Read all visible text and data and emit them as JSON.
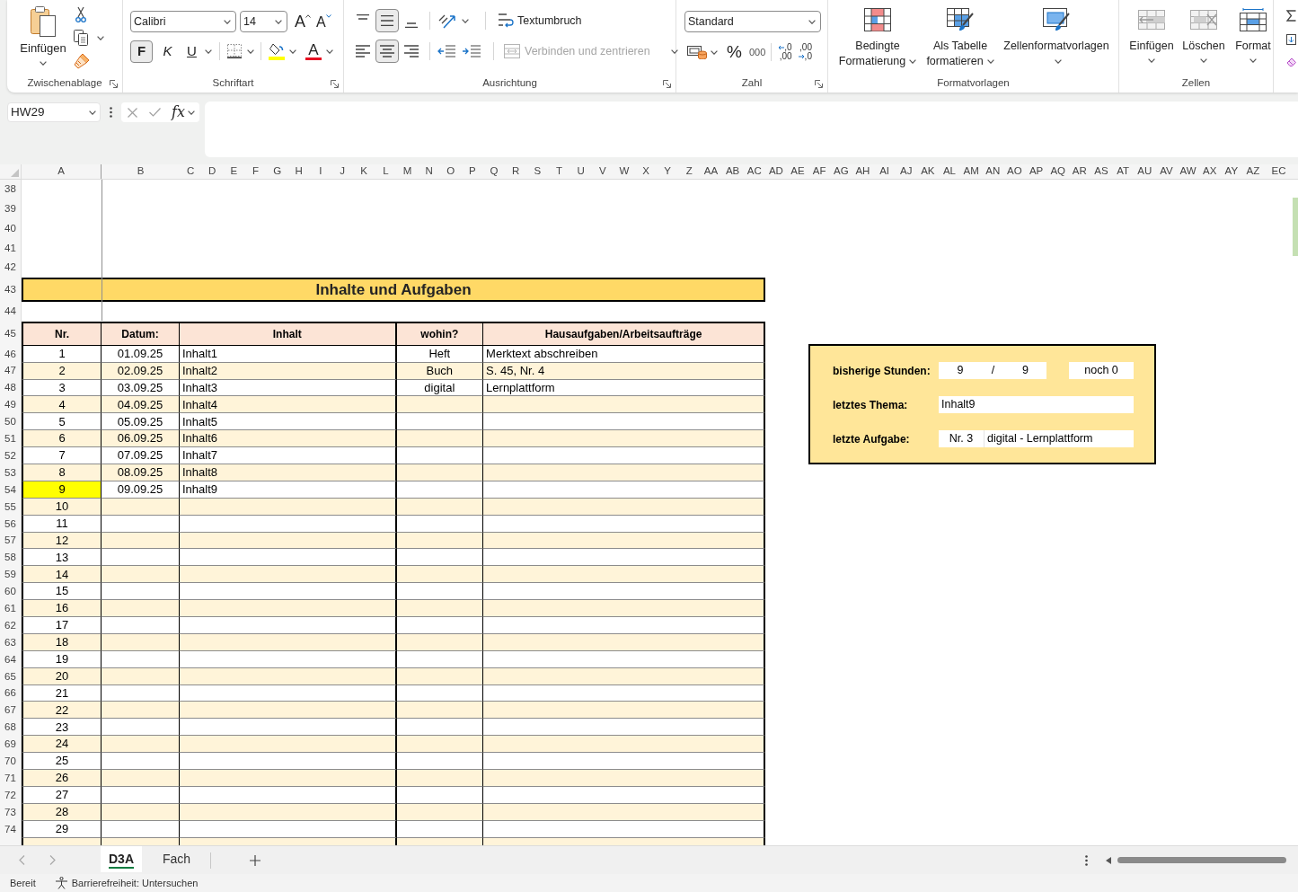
{
  "ribbon": {
    "clipboard": {
      "paste": "Einfügen",
      "label": "Zwischenablage"
    },
    "font": {
      "font_name": "Calibri",
      "font_size": "14",
      "grow_glyph": "A",
      "shrink_glyph": "A",
      "styles": [
        {
          "label": "F",
          "selected": true
        },
        {
          "label": "K",
          "selected": false
        },
        {
          "label": "U",
          "selected": false
        }
      ],
      "font_color_glyph": "A",
      "label": "Schriftart"
    },
    "alignment": {
      "vertical": [
        {
          "kind": "top",
          "selected": false
        },
        {
          "kind": "middle",
          "selected": true
        },
        {
          "kind": "bottom",
          "selected": false
        }
      ],
      "wrap_text": "Textumbruch",
      "horizontal": [
        {
          "kind": "left",
          "selected": false
        },
        {
          "kind": "center",
          "selected": true
        },
        {
          "kind": "right",
          "selected": false
        }
      ],
      "merge": {
        "label": "Verbinden und zentrieren",
        "disabled": true
      },
      "label": "Ausrichtung"
    },
    "number": {
      "format": "Standard",
      "percent": "%",
      "thousands": "000",
      "decimals": [
        {
          "kind": "increase",
          "upper": ",0",
          "lower": ",00"
        },
        {
          "kind": "decrease",
          "upper": ",00",
          "lower": ",0"
        }
      ],
      "label": "Zahl"
    },
    "styles": {
      "buttons": [
        {
          "kind": "conditional",
          "label": "Bedingte Formatierung"
        },
        {
          "kind": "table",
          "label": "Als Tabelle formatieren"
        },
        {
          "kind": "cell_styles",
          "label": "Zellenformatvorlagen"
        }
      ],
      "label": "Formatvorlagen"
    },
    "cells": {
      "buttons": [
        {
          "kind": "insert",
          "label": "Einfügen"
        },
        {
          "kind": "delete",
          "label": "Löschen"
        },
        {
          "kind": "format",
          "label": "Format"
        }
      ],
      "label": "Zellen"
    }
  },
  "formula_bar": {
    "name_box": "HW29",
    "function_label": "fx"
  },
  "sheet": {
    "column_headers": [
      "A",
      "B",
      "C",
      "D",
      "E",
      "F",
      "G",
      "H",
      "I",
      "J",
      "K",
      "L",
      "M",
      "N",
      "O",
      "P",
      "Q",
      "R",
      "S",
      "T",
      "U",
      "V",
      "W",
      "X",
      "Y",
      "Z",
      "AA",
      "AB",
      "AC",
      "AD",
      "AE",
      "AF",
      "AG",
      "AH",
      "AI",
      "AJ",
      "AK",
      "AL",
      "AM",
      "AN",
      "AO",
      "AP",
      "AQ",
      "AR",
      "AS",
      "AT",
      "AU",
      "AV",
      "AW",
      "AX",
      "AY",
      "AZ",
      "EC"
    ],
    "rows": [
      {
        "number": "38",
        "kind": "blank"
      },
      {
        "number": "39",
        "kind": "blank"
      },
      {
        "number": "40",
        "kind": "blank"
      },
      {
        "number": "41",
        "kind": "blank"
      },
      {
        "number": "42",
        "kind": "blank"
      },
      {
        "number": "43",
        "kind": "title",
        "title": "Inhalte und Aufgaben"
      },
      {
        "number": "44",
        "kind": "blank"
      },
      {
        "number": "45",
        "kind": "header",
        "cells": [
          "Nr.",
          "Datum:",
          "Inhalt",
          "wohin?",
          "Hausaufgaben/Arbeitsaufträge"
        ]
      },
      {
        "number": "46",
        "kind": "entry",
        "nr": "1",
        "date": "01.09.25",
        "content": "Inhalt1",
        "where": "Heft",
        "task": "Merktext abschreiben",
        "highlighted": false
      },
      {
        "number": "47",
        "kind": "entry",
        "nr": "2",
        "date": "02.09.25",
        "content": "Inhalt2",
        "where": "Buch",
        "task": "S. 45, Nr. 4",
        "highlighted": false
      },
      {
        "number": "48",
        "kind": "entry",
        "nr": "3",
        "date": "03.09.25",
        "content": "Inhalt3",
        "where": "digital",
        "task": "Lernplattform",
        "highlighted": false
      },
      {
        "number": "49",
        "kind": "entry",
        "nr": "4",
        "date": "04.09.25",
        "content": "Inhalt4",
        "highlighted": false
      },
      {
        "number": "50",
        "kind": "entry",
        "nr": "5",
        "date": "05.09.25",
        "content": "Inhalt5",
        "highlighted": false
      },
      {
        "number": "51",
        "kind": "entry",
        "nr": "6",
        "date": "06.09.25",
        "content": "Inhalt6",
        "highlighted": false
      },
      {
        "number": "52",
        "kind": "entry",
        "nr": "7",
        "date": "07.09.25",
        "content": "Inhalt7",
        "highlighted": false
      },
      {
        "number": "53",
        "kind": "entry",
        "nr": "8",
        "date": "08.09.25",
        "content": "Inhalt8",
        "highlighted": false
      },
      {
        "number": "54",
        "kind": "entry",
        "nr": "9",
        "date": "09.09.25",
        "content": "Inhalt9",
        "highlighted": true
      },
      {
        "number": "55",
        "kind": "entry",
        "nr": "10",
        "highlighted": false
      },
      {
        "number": "56",
        "kind": "entry",
        "nr": "11",
        "highlighted": false
      },
      {
        "number": "57",
        "kind": "entry",
        "nr": "12",
        "highlighted": false
      },
      {
        "number": "58",
        "kind": "entry",
        "nr": "13",
        "highlighted": false
      },
      {
        "number": "59",
        "kind": "entry",
        "nr": "14",
        "highlighted": false
      },
      {
        "number": "60",
        "kind": "entry",
        "nr": "15",
        "highlighted": false
      },
      {
        "number": "61",
        "kind": "entry",
        "nr": "16",
        "highlighted": false
      },
      {
        "number": "62",
        "kind": "entry",
        "nr": "17",
        "highlighted": false
      },
      {
        "number": "63",
        "kind": "entry",
        "nr": "18",
        "highlighted": false
      },
      {
        "number": "64",
        "kind": "entry",
        "nr": "19",
        "highlighted": false
      },
      {
        "number": "65",
        "kind": "entry",
        "nr": "20",
        "highlighted": false
      },
      {
        "number": "66",
        "kind": "entry",
        "nr": "21",
        "highlighted": false
      },
      {
        "number": "67",
        "kind": "entry",
        "nr": "22",
        "highlighted": false
      },
      {
        "number": "68",
        "kind": "entry",
        "nr": "23",
        "highlighted": false
      },
      {
        "number": "69",
        "kind": "entry",
        "nr": "24",
        "highlighted": false
      },
      {
        "number": "70",
        "kind": "entry",
        "nr": "25",
        "highlighted": false
      },
      {
        "number": "71",
        "kind": "entry",
        "nr": "26",
        "highlighted": false
      },
      {
        "number": "72",
        "kind": "entry",
        "nr": "27",
        "highlighted": false
      },
      {
        "number": "73",
        "kind": "entry",
        "nr": "28",
        "highlighted": false
      },
      {
        "number": "74",
        "kind": "entry",
        "nr": "29",
        "highlighted": false
      }
    ],
    "summary": {
      "hours_label": "bisherige Stunden:",
      "hours_done": "9",
      "hours_separator": "/",
      "hours_total": "9",
      "remaining": "noch 0",
      "topic_label": "letztes Thema:",
      "topic": "Inhalt9",
      "task_label": "letzte Aufgabe:",
      "task_nr": "Nr. 3",
      "task": "digital - Lernplattform"
    }
  },
  "sheet_tabs": [
    {
      "label": "D3A",
      "selected": true
    },
    {
      "label": "Fach",
      "selected": false
    }
  ],
  "status_bar": {
    "status": "Bereit",
    "accessibility": "Barrierefreiheit: Untersuchen"
  }
}
